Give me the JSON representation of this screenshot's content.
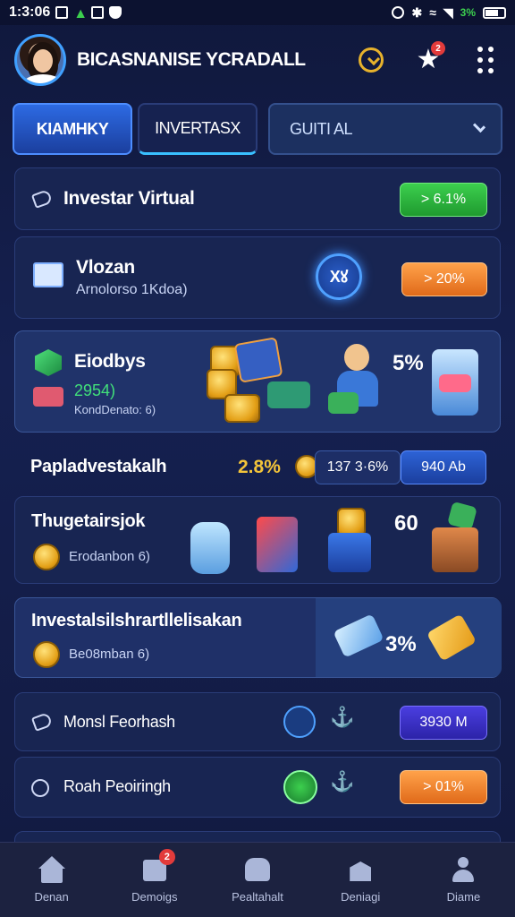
{
  "status_bar": {
    "time": "1:3:06",
    "battery_text": "3%"
  },
  "header": {
    "title": "BICASNANISE YCRADALL",
    "notif_count": "2"
  },
  "tabs": [
    {
      "label": "KIAMHKY"
    },
    {
      "label": "INVERTASX"
    },
    {
      "label": "GUITI AL"
    }
  ],
  "cards": {
    "investar": {
      "title": "Investar Virtual",
      "pill": "> 6.1%"
    },
    "vlozan": {
      "title": "Vlozan",
      "subtitle": "Arnolorso 1Kdoa)",
      "badge": "Xꙋ",
      "pill": "> 20%"
    },
    "eiodbys": {
      "title": "Eiodbys",
      "value": "2954)",
      "subtitle": "KondDenato: 6)",
      "pct": "5%"
    },
    "papla": {
      "title": "Papladvestakalh",
      "pct": "2.8%",
      "value2": "137 3·6%",
      "pill": "940 Ab"
    },
    "thuget": {
      "title": "Thugetairsjok",
      "subtitle": "Erodanbon 6)",
      "pct": "60"
    },
    "invest_long": {
      "title": "Investalsilshrartllelisakan",
      "subtitle": "Be08mban 6)",
      "pct": "3%"
    },
    "monsl": {
      "title": "Monsl Feorhash",
      "pill": "3930 M"
    },
    "roah": {
      "title": "Roah Peoiringh",
      "pill": "> 01%"
    }
  },
  "bottom_nav": [
    {
      "label": "Denan"
    },
    {
      "label": "Demoigs",
      "badge": "2"
    },
    {
      "label": "Pealtahalt"
    },
    {
      "label": "Deniagi"
    },
    {
      "label": "Diame"
    }
  ],
  "colors": {
    "accent_blue": "#2d6ae3",
    "green": "#3ccf4e",
    "orange": "#ffa24a",
    "purple": "#4a3ee0"
  }
}
